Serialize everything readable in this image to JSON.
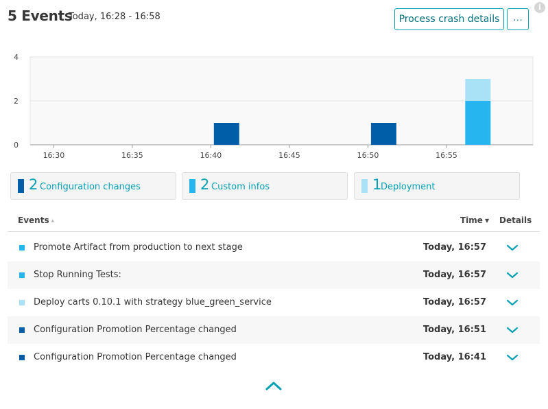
{
  "header": {
    "title": "5 Events",
    "timeframe": "Today, 16:28 - 16:58",
    "process_crash_label": "Process crash details",
    "more_label": "···",
    "info_label": "i"
  },
  "chart_data": {
    "type": "bar",
    "stacked": true,
    "x_tick_labels": [
      "16:30",
      "16:35",
      "16:40",
      "16:45",
      "16:50",
      "16:55"
    ],
    "ylim": [
      0,
      4
    ],
    "y_ticks": [
      "0",
      "2",
      "4"
    ],
    "grid": true,
    "series": [
      {
        "name": "Configuration changes",
        "color": "#005ea8",
        "points": [
          {
            "x": "16:41",
            "y": 1
          },
          {
            "x": "16:51",
            "y": 1
          }
        ]
      },
      {
        "name": "Custom infos",
        "color": "#27b5f0",
        "points": [
          {
            "x": "16:57",
            "y": 2
          }
        ]
      },
      {
        "name": "Deployment",
        "color": "#a9e1f7",
        "points": [
          {
            "x": "16:57",
            "y": 1
          }
        ]
      }
    ]
  },
  "legend": [
    {
      "count": "2",
      "label": "Configuration changes",
      "color": "#005ea8"
    },
    {
      "count": "2",
      "label": "Custom infos",
      "color": "#27b5f0"
    },
    {
      "count": "1",
      "label": "Deployment",
      "color": "#a9e1f7"
    }
  ],
  "table": {
    "headers": {
      "events": "Events",
      "time": "Time",
      "details": "Details"
    },
    "rows": [
      {
        "description": "Promote Artifact from production to next stage",
        "time": "Today, 16:57",
        "color": "#27b5f0"
      },
      {
        "description": "Stop Running Tests:",
        "time": "Today, 16:57",
        "color": "#27b5f0"
      },
      {
        "description": "Deploy carts 0.10.1 with strategy blue_green_service",
        "time": "Today, 16:57",
        "color": "#a9e1f7"
      },
      {
        "description": "Configuration Promotion Percentage changed",
        "time": "Today, 16:51",
        "color": "#005ea8"
      },
      {
        "description": "Configuration Promotion Percentage changed",
        "time": "Today, 16:41",
        "color": "#005ea8"
      }
    ]
  }
}
